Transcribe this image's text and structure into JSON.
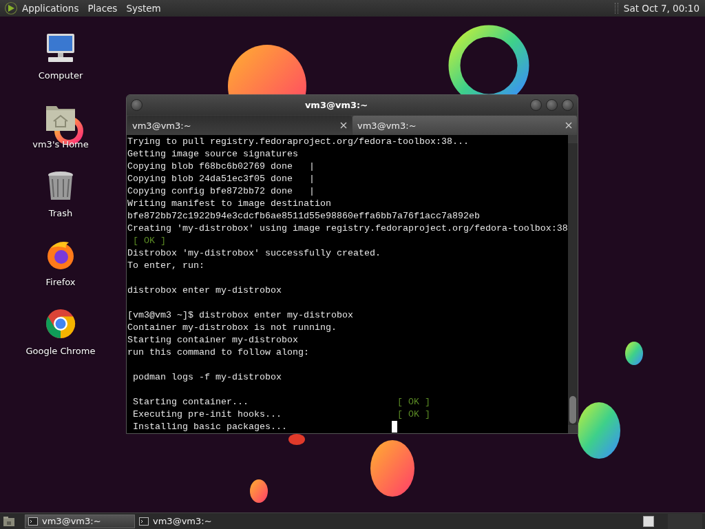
{
  "top_panel": {
    "menus": [
      {
        "label": "Applications"
      },
      {
        "label": "Places"
      },
      {
        "label": "System"
      }
    ],
    "clock": "Sat Oct 7, 00:10"
  },
  "desktop_icons": [
    {
      "label": "Computer",
      "kind": "computer"
    },
    {
      "label": "vm3's Home",
      "kind": "home"
    },
    {
      "label": "Trash",
      "kind": "trash"
    },
    {
      "label": "Firefox",
      "kind": "firefox"
    },
    {
      "label": "Google Chrome",
      "kind": "chrome"
    }
  ],
  "window": {
    "title": "vm3@vm3:~",
    "tabs": [
      {
        "label": "vm3@vm3:~",
        "selected": false
      },
      {
        "label": "vm3@vm3:~",
        "selected": true
      }
    ],
    "terminal_lines": [
      {
        "kind": "plain",
        "text": "Trying to pull registry.fedoraproject.org/fedora-toolbox:38..."
      },
      {
        "kind": "plain",
        "text": "Getting image source signatures"
      },
      {
        "kind": "plain",
        "text": "Copying blob f68bc6b02769 done   |"
      },
      {
        "kind": "plain",
        "text": "Copying blob 24da51ec3f05 done   |"
      },
      {
        "kind": "plain",
        "text": "Copying config bfe872bb72 done   |"
      },
      {
        "kind": "plain",
        "text": "Writing manifest to image destination"
      },
      {
        "kind": "plain",
        "text": "bfe872bb72c1922b94e3cdcfb6ae8511d55e98860effa6bb7a76f1acc7a892eb"
      },
      {
        "kind": "plain",
        "text": "Creating 'my-distrobox' using image registry.fedoraproject.org/fedora-toolbox:38"
      },
      {
        "kind": "ok",
        "text": " [ OK ]"
      },
      {
        "kind": "plain",
        "text": "Distrobox 'my-distrobox' successfully created."
      },
      {
        "kind": "plain",
        "text": "To enter, run:"
      },
      {
        "kind": "blank"
      },
      {
        "kind": "plain",
        "text": "distrobox enter my-distrobox"
      },
      {
        "kind": "blank"
      },
      {
        "kind": "plain",
        "text": "[vm3@vm3 ~]$ distrobox enter my-distrobox"
      },
      {
        "kind": "plain",
        "text": "Container my-distrobox is not running."
      },
      {
        "kind": "plain",
        "text": "Starting container my-distrobox"
      },
      {
        "kind": "plain",
        "text": "run this command to follow along:"
      },
      {
        "kind": "blank"
      },
      {
        "kind": "plain",
        "text": " podman logs -f my-distrobox"
      },
      {
        "kind": "blank"
      },
      {
        "kind": "status",
        "text": " Starting container...",
        "status": "[ OK ]"
      },
      {
        "kind": "status",
        "text": " Executing pre-init hooks...",
        "status": "[ OK ]"
      },
      {
        "kind": "status",
        "text": " Installing basic packages...",
        "cursor": true
      }
    ]
  },
  "taskbar": {
    "items": [
      {
        "label": "vm3@vm3:~",
        "selected": true
      },
      {
        "label": "vm3@vm3:~",
        "selected": false
      }
    ]
  }
}
